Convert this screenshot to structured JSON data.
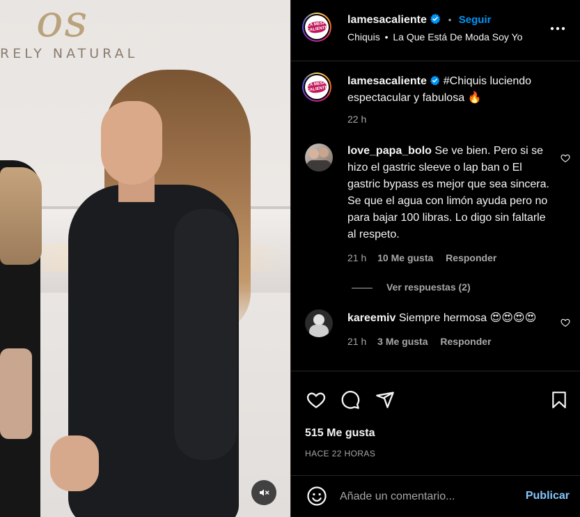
{
  "media": {
    "wall_logo_text": "os",
    "wall_text": "RELY NATURAL",
    "mute_icon": "speaker-muted-icon"
  },
  "header": {
    "username": "lamesacaliente",
    "verified_icon": "verified-badge-icon",
    "separator": "•",
    "follow_label": "Seguir",
    "audio_artist": "Chiquis",
    "audio_separator": "•",
    "audio_title": "La Que Está De Moda Soy Yo",
    "more_icon": "more-options-icon",
    "logo_line1": "LA MESA",
    "logo_line2": "CALIENTE"
  },
  "caption": {
    "username": "lamesacaliente",
    "text": "#Chiquis luciendo espectacular y fabulosa 🔥",
    "time": "22 h"
  },
  "comments": [
    {
      "username": "love_papa_bolo",
      "text": "Se ve bien. Pero si se hizo el gastric sleeve o lap ban o El gastric bypass es mejor que sea sincera. Se que el agua con limón ayuda pero no para bajar 100 libras. Lo digo sin faltarle al respeto.",
      "time": "21 h",
      "likes": "10 Me gusta",
      "reply_label": "Responder",
      "view_replies": "Ver respuestas (2)"
    },
    {
      "username": "kareemiv",
      "text": "Siempre hermosa 😍😍😍😍",
      "time": "21 h",
      "likes": "3 Me gusta",
      "reply_label": "Responder"
    }
  ],
  "actions": {
    "like_icon": "heart-icon",
    "comment_icon": "comment-icon",
    "share_icon": "share-icon",
    "save_icon": "bookmark-icon",
    "likes_count": "515 Me gusta",
    "posted": "HACE 22 HORAS"
  },
  "composer": {
    "emoji_icon": "emoji-icon",
    "placeholder": "Añade un comentario...",
    "post_label": "Publicar"
  },
  "colors": {
    "accent": "#0095f6",
    "post_button": "#85c7ff",
    "muted_text": "#a8a8a8",
    "background": "#000000"
  }
}
